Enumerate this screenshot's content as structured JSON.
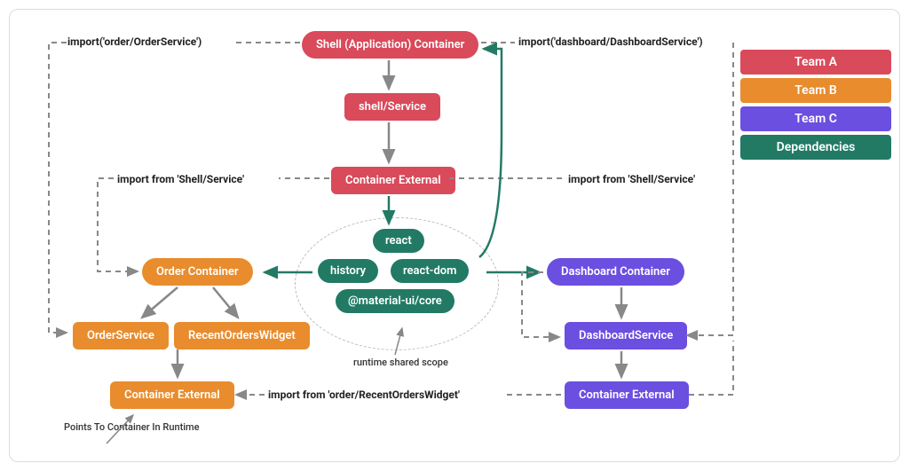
{
  "legend": {
    "team_a": "Team A",
    "team_b": "Team B",
    "team_c": "Team C",
    "deps": "Dependencies"
  },
  "nodes": {
    "shell_container": "Shell (Application) Container",
    "shell_service": "shell/Service",
    "shell_external": "Container External",
    "order_container": "Order Container",
    "order_service": "OrderService",
    "recent_orders_widget": "RecentOrdersWidget",
    "order_external": "Container External",
    "dashboard_container": "Dashboard Container",
    "dashboard_service": "DashboardService",
    "dashboard_external": "Container External",
    "dep_react": "react",
    "dep_history": "history",
    "dep_react_dom": "react-dom",
    "dep_material": "@material-ui/core"
  },
  "labels": {
    "import_order_service": "import('order/OrderService')",
    "import_dashboard_service": "import('dashboard/DashboardService')",
    "import_from_shell_left": "import from 'Shell/Service'",
    "import_from_shell_right": "import from 'Shell/Service'",
    "import_from_recent_orders": "import from 'order/RecentOrdersWidget'",
    "runtime_shared_scope": "runtime shared scope",
    "points_to_container": "Points To Container In Runtime"
  }
}
